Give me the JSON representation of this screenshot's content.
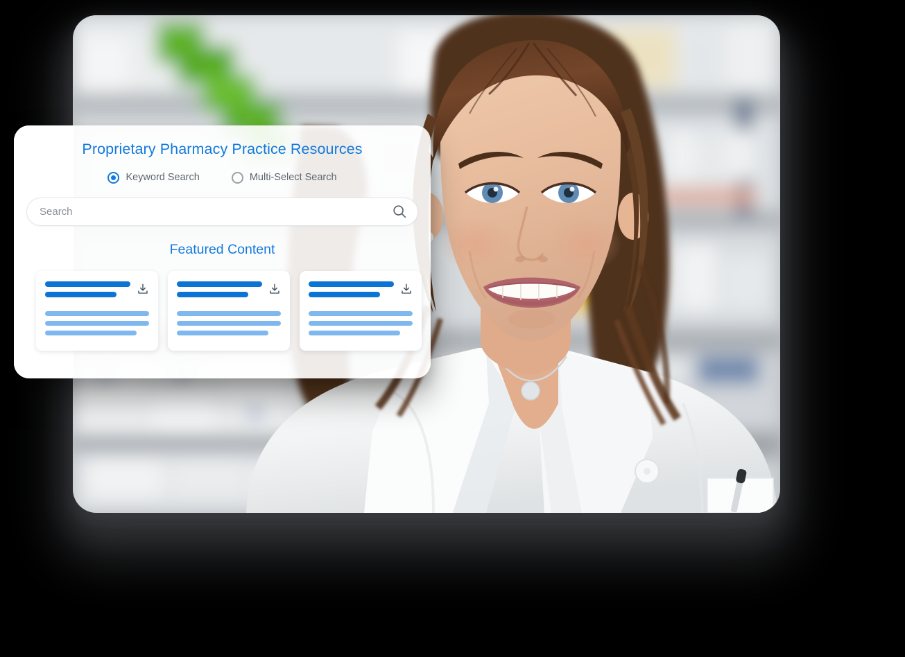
{
  "page": {
    "background_color": "#000000"
  },
  "hero_photo": {
    "name": "pharmacist-portrait-photo",
    "description": "Smiling female pharmacist in white lab coat standing in front of blurred pharmacy shelves",
    "corner_radius_px": 34
  },
  "panel": {
    "title": "Proprietary Pharmacy Practice Resources",
    "title_color": "#1479dd",
    "background_color": "#ffffff",
    "search_mode": {
      "options": [
        {
          "label": "Keyword Search",
          "selected": true
        },
        {
          "label": "Multi-Select Search",
          "selected": false
        }
      ]
    },
    "search": {
      "placeholder": "Search",
      "value": "",
      "icon": "search-icon"
    },
    "featured": {
      "heading": "Featured Content",
      "heading_color": "#1479dd",
      "cards": [
        {
          "icon": "download-icon",
          "title_bars": [
            100,
            84
          ],
          "body_bars": [
            100,
            100,
            88
          ],
          "title_bar_color": "#0c74d4",
          "body_bar_color": "#7eb8ef"
        },
        {
          "icon": "download-icon",
          "title_bars": [
            100,
            84
          ],
          "body_bars": [
            100,
            100,
            88
          ],
          "title_bar_color": "#0c74d4",
          "body_bar_color": "#7eb8ef"
        },
        {
          "icon": "download-icon",
          "title_bars": [
            100,
            84
          ],
          "body_bars": [
            100,
            100,
            88
          ],
          "title_bar_color": "#0c74d4",
          "body_bar_color": "#7eb8ef"
        }
      ]
    }
  }
}
